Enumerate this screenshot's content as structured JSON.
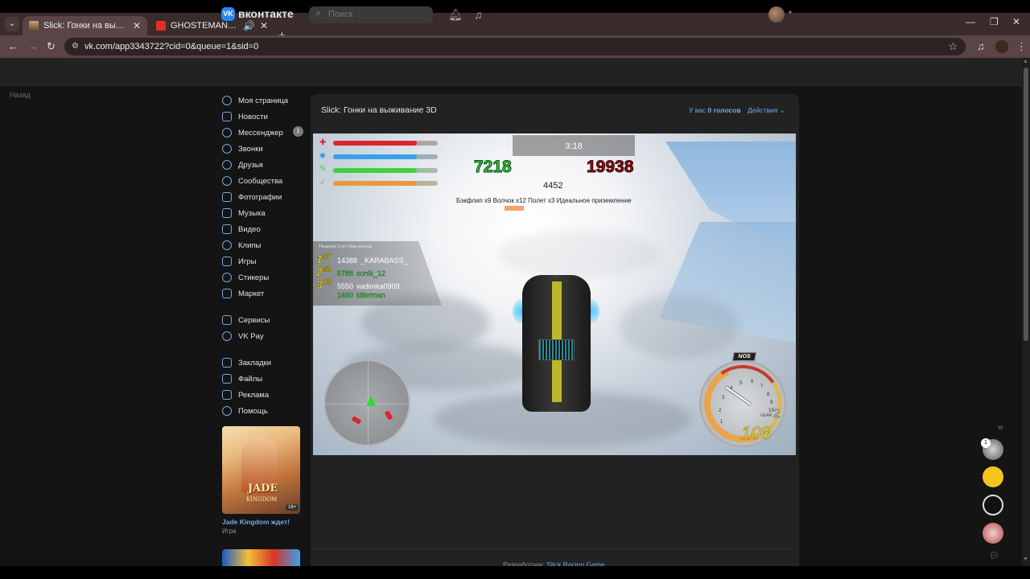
{
  "browser": {
    "tabs": [
      {
        "title": "Slick: Гонки на выживание 3D",
        "active": true
      },
      {
        "title": "GHOSTEMANE - Mercury -",
        "active": false
      }
    ],
    "url": "vk.com/app3343722?cid=0&queue=1&sid=0"
  },
  "vk": {
    "brand": "вконтакте",
    "search_placeholder": "Поиск",
    "back": "Назад",
    "menu": {
      "group1": [
        "Моя страница",
        "Новости",
        "Мессенджер",
        "Звонки",
        "Друзья",
        "Сообщества",
        "Фотографии",
        "Музыка",
        "Видео",
        "Клипы",
        "Игры",
        "Стикеры",
        "Маркет"
      ],
      "group2": [
        "Сервисы",
        "VK Pay"
      ],
      "group3": [
        "Закладки",
        "Файлы",
        "Реклама",
        "Помощь"
      ],
      "messenger_badge": "1"
    },
    "ad": {
      "art_line1": "JADE",
      "art_line2": "KINGDOM",
      "age": "16+",
      "title": "Jade Kingdom ждет!",
      "subtitle": "Игра"
    }
  },
  "app": {
    "title": "Slick: Гонки на выживание 3D",
    "votes_prefix": "У вас ",
    "votes_count": "0 голосов",
    "actions": "Действия",
    "footer_label": "Разработчик: ",
    "footer_link": "Slick Racing Game"
  },
  "game": {
    "timer": "3:18",
    "timer_faint": "18pm",
    "score_green": "7218",
    "score_red": "19938",
    "score_mid": "4452",
    "tricks": "Бэкфлип x9  Волчок x12  Полет x3  Идеальное приземление",
    "leaderboard_header": "Позиция    Счет    Имя игрока",
    "leaderboard": [
      {
        "pos": "1",
        "suffix": "ST",
        "score": "14388",
        "name": "_KARABASS_",
        "green": false
      },
      {
        "pos": "2",
        "suffix": "ND",
        "score": "5788",
        "name": "sonik_12",
        "green": true
      },
      {
        "pos": "3",
        "suffix": "RD",
        "score": "5550",
        "name": "vadimka0909",
        "green": false
      },
      {
        "pos": "",
        "suffix": "",
        "score": "1460",
        "name": "killerman",
        "green": true
      }
    ],
    "nos": "NOS",
    "gear_label": "GEAR",
    "gear": "2",
    "speed": "108",
    "dial_numbers": [
      "1",
      "2",
      "3",
      "4",
      "5",
      "6",
      "7",
      "8",
      "9",
      "10"
    ],
    "health_fill": 0.8,
    "shield_fill": 0.8,
    "nitro_fill": 0.8,
    "ammo_fill": 0.8
  },
  "rail": {
    "badge": "1"
  },
  "colors": {
    "vk_blue": "#2787f5",
    "link": "#71aaeb",
    "health": "#d8262e",
    "shield": "#3aa0e8",
    "nitro": "#3ed33a",
    "ammo": "#e89a3a"
  }
}
